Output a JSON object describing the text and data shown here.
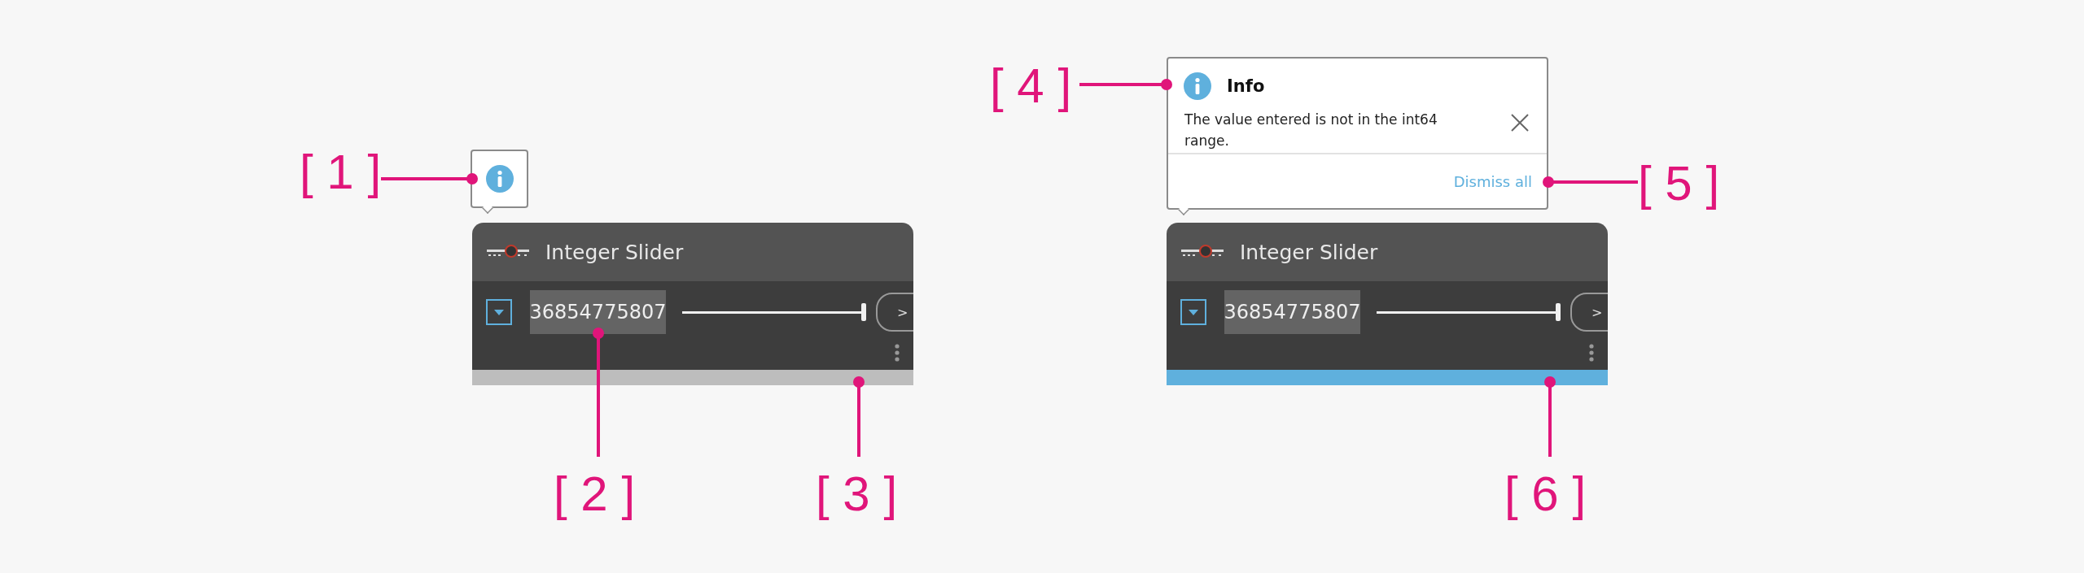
{
  "nodes": [
    {
      "title": "Integer Slider",
      "value": "36854775807",
      "level": 1,
      "button_label": ">",
      "color": "#bdbdbd",
      "notice": {
        "kind": "collapsed"
      }
    },
    {
      "title": "Integer Slider",
      "value": "36854775807",
      "level": 1,
      "button_label": ">",
      "color": "#5fb0dd",
      "notice": {
        "kind": "expanded",
        "title": "Info",
        "message": "The value entered is not in the int64 range.",
        "dismiss": "Dismiss all"
      }
    }
  ],
  "callouts": [
    {
      "label": "[ 1 ]"
    },
    {
      "label": "[ 2 ]"
    },
    {
      "label": "[ 3 ]"
    },
    {
      "label": "[ 4 ]"
    },
    {
      "label": "[ 5 ]"
    },
    {
      "label": "[ 6 ]"
    }
  ]
}
